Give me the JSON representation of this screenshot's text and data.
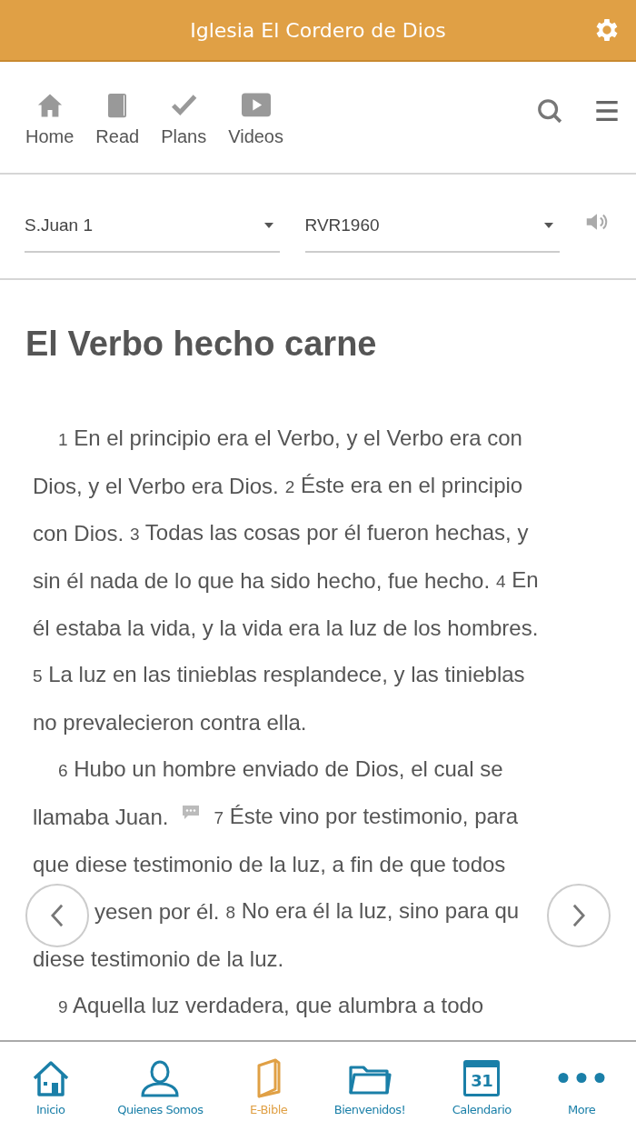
{
  "header": {
    "title": "Iglesia El Cordero de Dios"
  },
  "toolbar": [
    {
      "kind": "home",
      "label": "Home"
    },
    {
      "kind": "book",
      "label": "Read"
    },
    {
      "kind": "check",
      "label": "Plans"
    },
    {
      "kind": "video",
      "label": "Videos"
    }
  ],
  "selectors": [
    {
      "value": "S.Juan 1"
    },
    {
      "value": "RVR1960"
    }
  ],
  "heading": "El Verbo hecho carne",
  "paragraphs": [
    {
      "lines": [
        [
          {
            "kind": "verse",
            "number": "1",
            "text": "En el principio era el Verbo, y el Verbo era con"
          }
        ],
        [
          {
            "kind": "text",
            "text": "Dios, y el Verbo era Dios."
          },
          {
            "kind": "verse",
            "number": "2",
            "text": "Éste era en el principio"
          }
        ],
        [
          {
            "kind": "text",
            "text": "con Dios."
          },
          {
            "kind": "verse",
            "number": "3",
            "text": "Todas las cosas por él fueron hechas, y"
          }
        ],
        [
          {
            "kind": "text",
            "text": "sin él nada de lo que ha sido hecho, fue hecho."
          },
          {
            "kind": "verse",
            "number": "4",
            "text": "En"
          }
        ],
        [
          {
            "kind": "text",
            "text": "él estaba la vida, y la vida era la luz de los hombres."
          }
        ],
        [
          {
            "kind": "verse",
            "number": "5",
            "text": "La luz en las tinieblas resplandece, y las tinieblas"
          }
        ],
        [
          {
            "kind": "text",
            "text": "no prevalecieron contra ella."
          }
        ]
      ]
    },
    {
      "lines": [
        [
          {
            "kind": "verse",
            "number": "6",
            "text": "Hubo un hombre enviado de Dios, el cual se"
          }
        ],
        [
          {
            "kind": "text",
            "text": "llamaba Juan."
          },
          {
            "kind": "note"
          },
          {
            "kind": "verse",
            "number": "7",
            "text": "Éste vino por testimonio, para"
          }
        ],
        [
          {
            "kind": "text",
            "text": "que diese testimonio de la luz, a fin de que todos"
          }
        ],
        [
          {
            "kind": "partial",
            "text": "yesen por él."
          },
          {
            "kind": "verse",
            "number": "8",
            "text": "No era él la luz, sino para qu"
          }
        ],
        [
          {
            "kind": "text",
            "text": "diese testimonio de la luz."
          }
        ]
      ]
    },
    {
      "lines": [
        [
          {
            "kind": "verse",
            "number": "9",
            "text": "Aquella luz verdadera, que alumbra a todo"
          }
        ]
      ]
    }
  ],
  "bottom_nav": [
    {
      "kind": "home",
      "label": "Inicio",
      "selected": false
    },
    {
      "kind": "person",
      "label": "Quienes Somos",
      "selected": false
    },
    {
      "kind": "book",
      "label": "E-Bible",
      "selected": true
    },
    {
      "kind": "folder",
      "label": "Bienvenidos!",
      "selected": false
    },
    {
      "kind": "calendar",
      "label": "Calendario",
      "selected": false,
      "day": "31"
    },
    {
      "kind": "more",
      "label": "More",
      "selected": false
    }
  ]
}
